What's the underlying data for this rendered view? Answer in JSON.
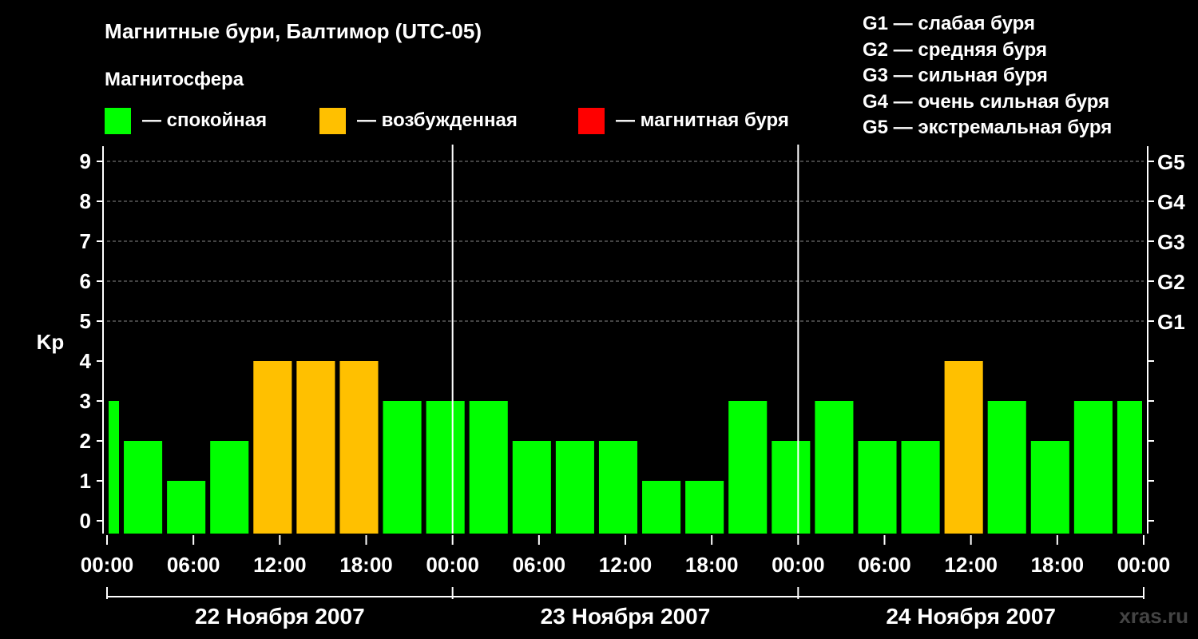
{
  "header": {
    "title": "Магнитные бури, Балтимор (UTC-05)",
    "subtitle": "Магнитосфера"
  },
  "legend": [
    {
      "label": "— спокойная",
      "color": "#00ff00"
    },
    {
      "label": "— возбужденная",
      "color": "#ffc000"
    },
    {
      "label": "— магнитная буря",
      "color": "#ff0000"
    }
  ],
  "g_scale": [
    "G1 — слабая буря",
    "G2 — средняя буря",
    "G3 — сильная буря",
    "G4 — очень сильная буря",
    "G5 — экстремальная буря"
  ],
  "watermark": "xras.ru",
  "chart_data": {
    "type": "bar",
    "ylabel": "Kp",
    "ylim": [
      0,
      9
    ],
    "y_ticks": [
      "0",
      "1",
      "2",
      "3",
      "4",
      "5",
      "6",
      "7",
      "8",
      "9"
    ],
    "right_ticks": [
      {
        "value": 5,
        "label": "G1"
      },
      {
        "value": 6,
        "label": "G2"
      },
      {
        "value": 7,
        "label": "G3"
      },
      {
        "value": 8,
        "label": "G4"
      },
      {
        "value": 9,
        "label": "G5"
      }
    ],
    "x_tick_labels": [
      "00:00",
      "06:00",
      "12:00",
      "18:00",
      "00:00",
      "06:00",
      "12:00",
      "18:00",
      "00:00",
      "06:00",
      "12:00",
      "18:00",
      "00:00"
    ],
    "days": [
      "22 Ноября 2007",
      "23 Ноября 2007",
      "24 Ноября 2007"
    ],
    "grid": "dashed horizontal",
    "colors": {
      "quiet": "#00ff00",
      "active": "#ffc000",
      "storm": "#ff0000"
    },
    "bars": [
      {
        "start_hour": 0,
        "end_hour": 1,
        "kp": 3
      },
      {
        "start_hour": 1,
        "end_hour": 4,
        "kp": 2
      },
      {
        "start_hour": 4,
        "end_hour": 7,
        "kp": 1
      },
      {
        "start_hour": 7,
        "end_hour": 10,
        "kp": 2
      },
      {
        "start_hour": 10,
        "end_hour": 13,
        "kp": 4
      },
      {
        "start_hour": 13,
        "end_hour": 16,
        "kp": 4
      },
      {
        "start_hour": 16,
        "end_hour": 19,
        "kp": 4
      },
      {
        "start_hour": 19,
        "end_hour": 22,
        "kp": 3
      },
      {
        "start_hour": 22,
        "end_hour": 25,
        "kp": 3
      },
      {
        "start_hour": 25,
        "end_hour": 28,
        "kp": 3
      },
      {
        "start_hour": 28,
        "end_hour": 31,
        "kp": 2
      },
      {
        "start_hour": 31,
        "end_hour": 34,
        "kp": 2
      },
      {
        "start_hour": 34,
        "end_hour": 37,
        "kp": 2
      },
      {
        "start_hour": 37,
        "end_hour": 40,
        "kp": 1
      },
      {
        "start_hour": 40,
        "end_hour": 43,
        "kp": 1
      },
      {
        "start_hour": 43,
        "end_hour": 46,
        "kp": 3
      },
      {
        "start_hour": 46,
        "end_hour": 49,
        "kp": 2
      },
      {
        "start_hour": 49,
        "end_hour": 52,
        "kp": 3
      },
      {
        "start_hour": 52,
        "end_hour": 55,
        "kp": 2
      },
      {
        "start_hour": 55,
        "end_hour": 58,
        "kp": 2
      },
      {
        "start_hour": 58,
        "end_hour": 61,
        "kp": 4
      },
      {
        "start_hour": 61,
        "end_hour": 64,
        "kp": 3
      },
      {
        "start_hour": 64,
        "end_hour": 67,
        "kp": 2
      },
      {
        "start_hour": 67,
        "end_hour": 70,
        "kp": 3
      },
      {
        "start_hour": 70,
        "end_hour": 72,
        "kp": 3
      }
    ]
  }
}
